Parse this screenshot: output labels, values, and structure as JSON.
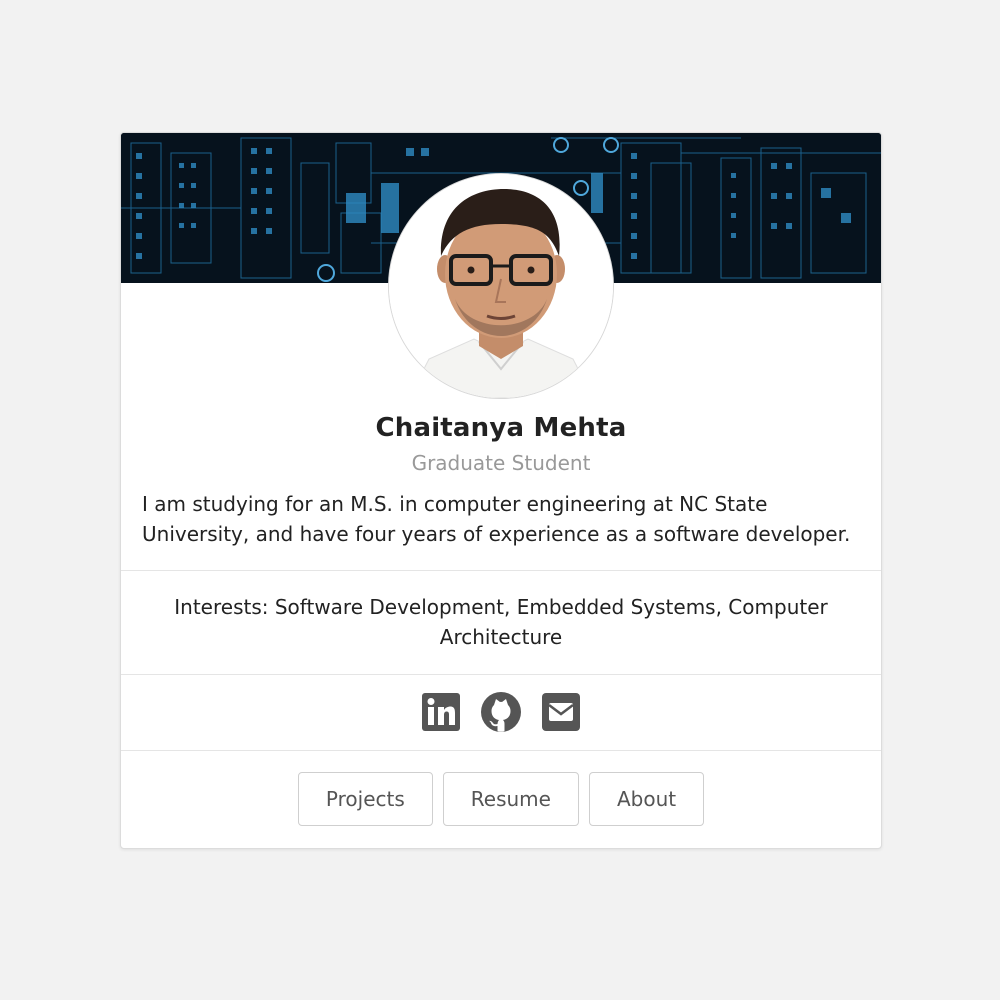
{
  "profile": {
    "name": "Chaitanya Mehta",
    "role": "Graduate Student",
    "bio": "I am studying for an M.S. in computer engineering at NC State University, and have four years of experience as a software developer.",
    "interests": "Interests: Software Development, Embedded Systems, Computer Architecture"
  },
  "socials": [
    {
      "icon": "linkedin-icon"
    },
    {
      "icon": "github-icon"
    },
    {
      "icon": "envelope-icon"
    }
  ],
  "buttons": {
    "projects": "Projects",
    "resume": "Resume",
    "about": "About"
  },
  "colors": {
    "page_background": "#f2f2f2",
    "banner_background": "#06121d",
    "circuit_accent": "#2f8bc4",
    "icon_gray": "#555555",
    "name_text": "#222222",
    "role_text": "#999999"
  }
}
